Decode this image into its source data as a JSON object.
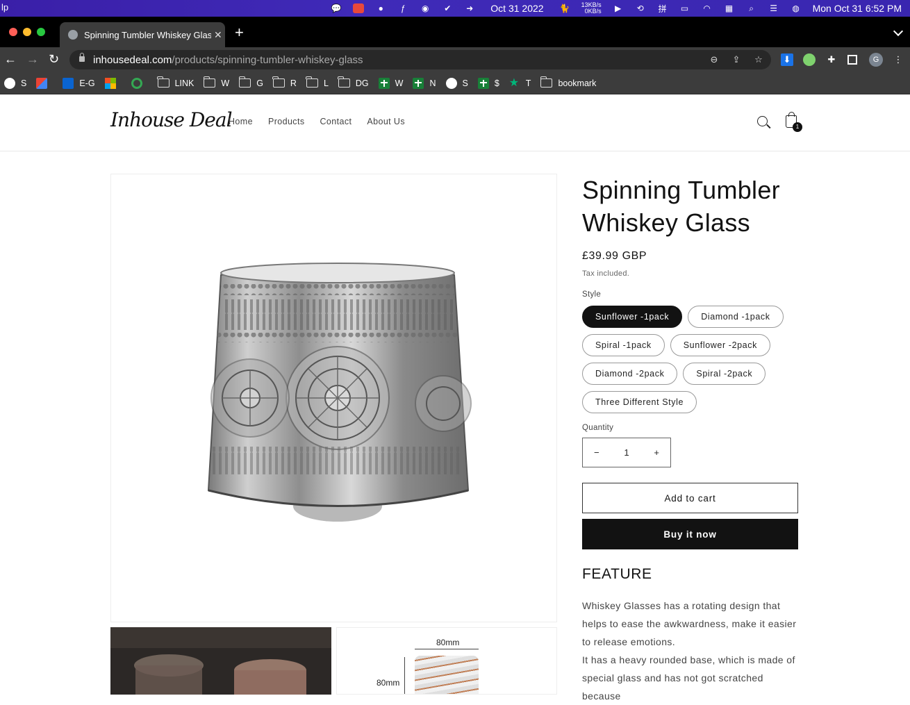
{
  "menubar": {
    "app_name": "lp",
    "date": "Oct 31 2022",
    "net_up": "13KB/s",
    "net_down": "0KB/s",
    "clock": "Mon Oct 31  6:52 PM",
    "icons": [
      "wechat-icon",
      "app-red-icon",
      "qq-icon",
      "feather-icon",
      "messenger-icon",
      "tick-icon",
      "arrow-circle-icon",
      "cat-icon",
      "play-icon",
      "history-icon",
      "input-icon",
      "battery-icon",
      "wifi-icon",
      "keyboard-icon",
      "spotlight-icon",
      "control-center-icon",
      "siri-icon"
    ]
  },
  "browser": {
    "tab_title": "Spinning Tumbler Whiskey Glass",
    "url_domain": "inhousedeal.com",
    "url_path": "/products/spinning-tumbler-whiskey-glass",
    "profile_initial": "G"
  },
  "bookmarks": [
    {
      "label": "S",
      "icon": "globe"
    },
    {
      "label": "",
      "icon": "gmail"
    },
    {
      "label": "E-G",
      "icon": "outlook"
    },
    {
      "label": "",
      "icon": "ms"
    },
    {
      "label": "",
      "icon": "g"
    },
    {
      "label": "LINK",
      "icon": "folder"
    },
    {
      "label": "W",
      "icon": "folder"
    },
    {
      "label": "G",
      "icon": "folder"
    },
    {
      "label": "R",
      "icon": "folder"
    },
    {
      "label": "L",
      "icon": "folder"
    },
    {
      "label": "DG",
      "icon": "folder"
    },
    {
      "label": "W",
      "icon": "sheet"
    },
    {
      "label": "N",
      "icon": "sheet"
    },
    {
      "label": "S",
      "icon": "globe"
    },
    {
      "label": "$",
      "icon": "sheet"
    },
    {
      "label": "T",
      "icon": "star"
    },
    {
      "label": "bookmark",
      "icon": "folder"
    }
  ],
  "store": {
    "logo": "Inhouse Deal",
    "nav": [
      "Home",
      "Products",
      "Contact",
      "About Us"
    ],
    "cart_count": "1"
  },
  "product": {
    "title": "Spinning Tumbler Whiskey Glass",
    "price": "£39.99 GBP",
    "tax_note": "Tax included.",
    "style_label": "Style",
    "styles": [
      "Sunflower -1pack",
      "Diamond -1pack",
      "Spiral -1pack",
      "Sunflower -2pack",
      "Diamond -2pack",
      "Spiral -2pack",
      "Three Different Style"
    ],
    "selected_style": "Sunflower -1pack",
    "quantity_label": "Quantity",
    "quantity": "1",
    "minus": "−",
    "plus": "+",
    "add_to_cart": "Add to cart",
    "buy_now": "Buy it now",
    "feature_heading": "FEATURE",
    "description": [
      "Whiskey Glasses has a rotating design that helps to ease the awkwardness, make it easier to release emotions.",
      "It has a heavy rounded base, which is made of special glass and has not got scratched because"
    ],
    "dim_width": "80mm",
    "dim_height": "80mm"
  }
}
